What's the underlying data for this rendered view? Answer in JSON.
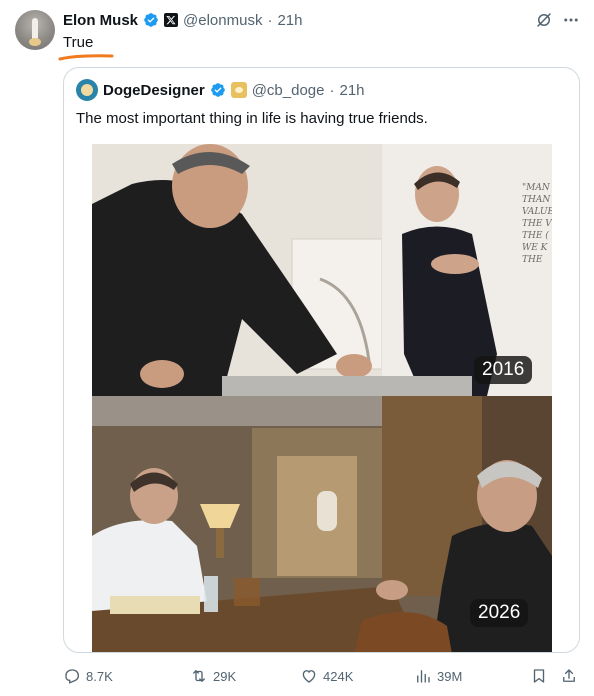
{
  "author": {
    "name": "Elon Musk",
    "handle": "@elonmusk",
    "separator": "·",
    "time": "21h"
  },
  "tweet_text": "True",
  "quote": {
    "name": "DogeDesigner",
    "handle": "@cb_doge",
    "separator": "·",
    "time": "21h",
    "text": "The most important thing in life is having true friends.",
    "photo": {
      "top_label": "2016",
      "bottom_label": "2026",
      "wall_text": [
        "\"MAN H",
        "THAN",
        "VALUE",
        "THE V",
        "THE (",
        "WE K",
        "THE"
      ]
    }
  },
  "actions": {
    "replies": "8.7K",
    "reposts": "29K",
    "likes": "424K",
    "views": "39M"
  },
  "colors": {
    "verified_blue": "#1d9bf0",
    "muted_text": "#536471",
    "underline_orange": "#f07a1e"
  },
  "icons": {
    "verified": "verified-check-icon",
    "x_badge": "x-logo-icon",
    "grok": "grok-icon",
    "more": "more-icon",
    "reply": "reply-icon",
    "repost": "repost-icon",
    "like": "like-icon",
    "views": "views-icon",
    "bookmark": "bookmark-icon",
    "share": "share-icon"
  }
}
